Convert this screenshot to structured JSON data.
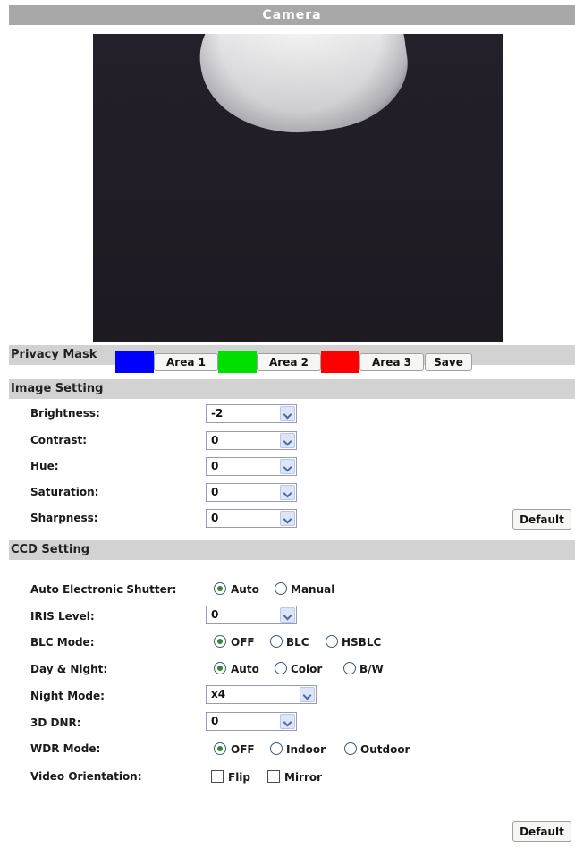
{
  "title": "Camera",
  "privacy_mask": {
    "heading": "Privacy Mask",
    "areas": [
      {
        "label": "Area 1",
        "color": "#0000ff"
      },
      {
        "label": "Area 2",
        "color": "#00e000"
      },
      {
        "label": "Area 3",
        "color": "#ff0000"
      }
    ],
    "save_label": "Save"
  },
  "image_setting": {
    "heading": "Image Setting",
    "fields": [
      {
        "label": "Brightness:",
        "value": "-2"
      },
      {
        "label": "Contrast:",
        "value": "0"
      },
      {
        "label": "Hue:",
        "value": "0"
      },
      {
        "label": "Saturation:",
        "value": "0"
      },
      {
        "label": "Sharpness:",
        "value": "0"
      }
    ],
    "default_label": "Default"
  },
  "ccd_setting": {
    "heading": "CCD Setting",
    "shutter": {
      "label": "Auto Electronic Shutter:",
      "options": [
        "Auto",
        "Manual"
      ],
      "selected": "Auto"
    },
    "iris": {
      "label": "IRIS Level:",
      "value": "0"
    },
    "blc": {
      "label": "BLC Mode:",
      "options": [
        "OFF",
        "BLC",
        "HSBLC"
      ],
      "selected": "OFF"
    },
    "day_night": {
      "label": "Day & Night:",
      "options": [
        "Auto",
        "Color",
        "B/W"
      ],
      "selected": "Auto"
    },
    "night_mode": {
      "label": "Night Mode:",
      "value": "x4"
    },
    "dnr": {
      "label": "3D DNR:",
      "value": "0"
    },
    "wdr": {
      "label": "WDR Mode:",
      "options": [
        "OFF",
        "Indoor",
        "Outdoor"
      ],
      "selected": "OFF"
    },
    "orientation": {
      "label": "Video Orientation:",
      "options": [
        "Flip",
        "Mirror"
      ],
      "checked": []
    },
    "default_label": "Default"
  }
}
